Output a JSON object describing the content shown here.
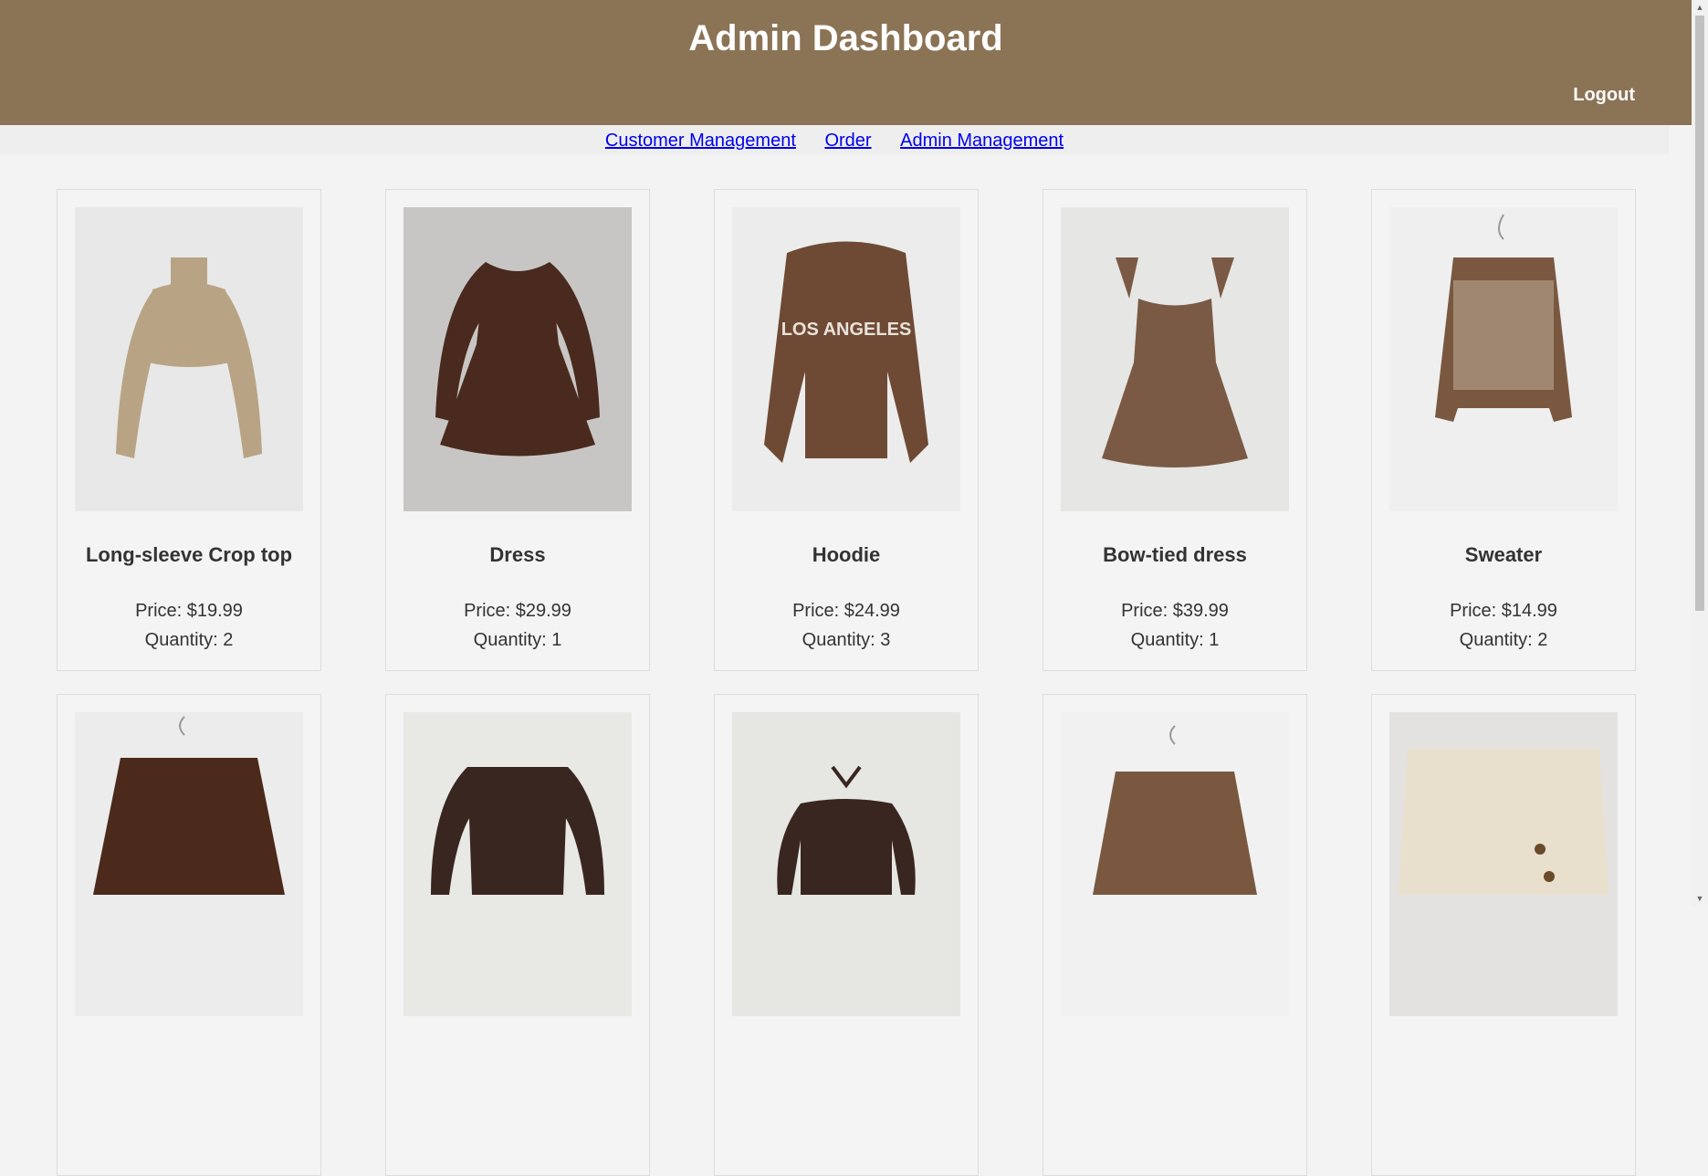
{
  "header": {
    "title": "Admin Dashboard",
    "logout_label": "Logout"
  },
  "nav": {
    "customer_management": "Customer Management",
    "order": "Order",
    "admin_management": "Admin Management"
  },
  "products": [
    {
      "name": "Long-sleeve Crop top",
      "price": "Price: $19.99",
      "quantity": "Quantity: 2"
    },
    {
      "name": "Dress",
      "price": "Price: $29.99",
      "quantity": "Quantity: 1"
    },
    {
      "name": "Hoodie",
      "price": "Price: $24.99",
      "quantity": "Quantity: 3"
    },
    {
      "name": "Bow-tied dress",
      "price": "Price: $39.99",
      "quantity": "Quantity: 1"
    },
    {
      "name": "Sweater",
      "price": "Price: $14.99",
      "quantity": "Quantity: 2"
    },
    {
      "name": "",
      "price": "",
      "quantity": ""
    },
    {
      "name": "",
      "price": "",
      "quantity": ""
    },
    {
      "name": "",
      "price": "",
      "quantity": ""
    },
    {
      "name": "",
      "price": "",
      "quantity": ""
    },
    {
      "name": "",
      "price": "",
      "quantity": ""
    }
  ],
  "images": [
    {
      "icon": "crop-top-image",
      "bg": "#e8e8e8",
      "garment": "#b8a484"
    },
    {
      "icon": "dress-image",
      "bg": "#c8c6c4",
      "garment": "#4a2a1e"
    },
    {
      "icon": "hoodie-image",
      "bg": "#ececec",
      "garment": "#6e4a35"
    },
    {
      "icon": "bow-tied-dress-image",
      "bg": "#e6e6e4",
      "garment": "#7a5a45"
    },
    {
      "icon": "sweater-image",
      "bg": "#efefef",
      "garment": "#7a5840"
    },
    {
      "icon": "v-neck-sweater-image",
      "bg": "#ececec",
      "garment": "#4b2a1c"
    },
    {
      "icon": "ruched-top-image",
      "bg": "#e8e8e4",
      "garment": "#3a2620"
    },
    {
      "icon": "halter-top-image",
      "bg": "#e6e6e2",
      "garment": "#3a2620"
    },
    {
      "icon": "cable-knit-cardigan-image",
      "bg": "#f1f1f1",
      "garment": "#7a5840"
    },
    {
      "icon": "cream-cardigan-image",
      "bg": "#e4e2e0",
      "garment": "#e8dfcd"
    }
  ]
}
